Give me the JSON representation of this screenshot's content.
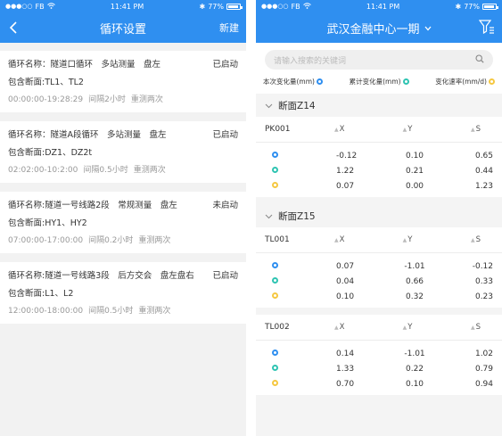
{
  "left": {
    "statusbar": {
      "carrier": "FB",
      "time": "11:41 PM",
      "battery": "77%"
    },
    "nav": {
      "title": "循环设置",
      "right_action": "新建"
    },
    "cards": [
      {
        "name": "循环名称：隧道口循环　多站测量　盘左",
        "status": "已启动",
        "sections": "包含断面:TL1、TL2",
        "time": "00:00:00-19:28:29",
        "interval": "间隔2小时",
        "retry": "重测两次"
      },
      {
        "name": "循环名称：隧道A段循环　多站测量　盘左",
        "status": "已启动",
        "sections": "包含断面:DZ1、DZ2t",
        "time": "02:02:00-10:2:00",
        "interval": "间隔0.5小时",
        "retry": "重测两次"
      },
      {
        "name": "循环名称:隧道一号线路2段　常规测量　盘左",
        "status": "未启动",
        "sections": "包含断面:HY1、HY2",
        "time": "07:00:00-17:00:00",
        "interval": "间隔0.2小时",
        "retry": "重测两次"
      },
      {
        "name": "循环名称:隧道一号线路3段　后方交会　盘左盘右",
        "status": "已启动",
        "sections": "包含断面:L1、L2",
        "time": "12:00:00-18:00:00",
        "interval": "间隔0.5小时",
        "retry": "重测两次"
      }
    ]
  },
  "right": {
    "statusbar": {
      "carrier": "FB",
      "time": "11:41 PM",
      "battery": "77%"
    },
    "nav": {
      "title": "武汉金融中心一期"
    },
    "search": {
      "placeholder": "请输入搜索的关键词"
    },
    "legend": [
      {
        "label": "本次变化量(mm)",
        "color": "#2f8ff0"
      },
      {
        "label": "累计变化量(mm)",
        "color": "#2fc4b2"
      },
      {
        "label": "变化速率(mm/d)",
        "color": "#f5c842"
      }
    ],
    "col_headers": {
      "x": "X",
      "y": "Y",
      "s": "S"
    },
    "sections": [
      {
        "name": "断面Z14",
        "points": [
          {
            "name": "PK001",
            "rows": [
              [
                "-0.12",
                "0.10",
                "0.65"
              ],
              [
                "1.22",
                "0.21",
                "0.44"
              ],
              [
                "0.07",
                "0.00",
                "1.23"
              ]
            ]
          }
        ]
      },
      {
        "name": "断面Z15",
        "points": [
          {
            "name": "TL001",
            "rows": [
              [
                "0.07",
                "-1.01",
                "-0.12"
              ],
              [
                "0.04",
                "0.66",
                "0.33"
              ],
              [
                "0.10",
                "0.32",
                "0.23"
              ]
            ]
          },
          {
            "name": "TL002",
            "rows": [
              [
                "0.14",
                "-1.01",
                "1.02"
              ],
              [
                "1.33",
                "0.22",
                "0.79"
              ],
              [
                "0.70",
                "0.10",
                "0.94"
              ]
            ]
          }
        ]
      }
    ]
  }
}
